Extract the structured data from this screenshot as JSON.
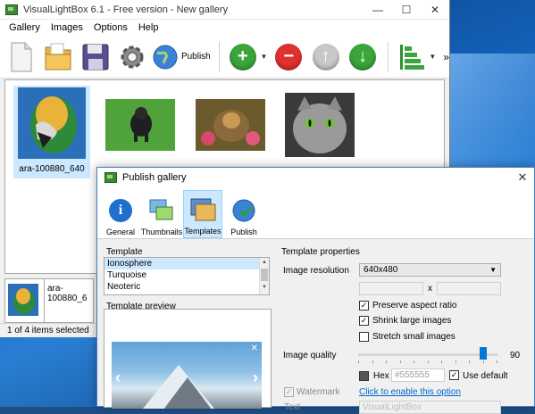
{
  "main_window": {
    "title": "VisualLightBox 6.1 - Free version - New gallery",
    "menu": [
      "Gallery",
      "Images",
      "Options",
      "Help"
    ],
    "toolbar": {
      "publish_label": "Publish",
      "buttons": [
        "new-document-icon",
        "open-folder-icon",
        "save-disk-icon",
        "settings-gear-icon",
        "publish-globe-icon",
        "add-icon",
        "remove-icon",
        "move-up-icon",
        "move-down-icon",
        "align-icon"
      ],
      "overflow": "»"
    },
    "gallery": {
      "selected_caption": "ara-100880_640"
    },
    "preview": {
      "name": "ara-100880_6"
    },
    "status": "1 of 4 items selected"
  },
  "dialog": {
    "title": "Publish gallery",
    "close": "✕",
    "tabs": [
      "General",
      "Thumbnails",
      "Templates",
      "Publish"
    ],
    "active_tab": "Templates",
    "template_group": "Template",
    "templates": [
      "Ionosphere",
      "Turquoise",
      "Neoteric"
    ],
    "selected_template": "Ionosphere",
    "template_preview_group": "Template preview",
    "properties_group": "Template properties",
    "image_resolution_label": "Image resolution",
    "image_resolution_value": "640x480",
    "x_separator": "x",
    "preserve_aspect": "Preserve aspect ratio",
    "shrink_large": "Shrink large images",
    "stretch_small": "Stretch small images",
    "image_quality_label": "Image quality",
    "image_quality_value": "90",
    "hex_label": "Hex",
    "hex_placeholder": "#555555",
    "use_default": "Use default",
    "watermark_label": "Watermark",
    "watermark_link": "Click to enable this option",
    "text_label": "Text",
    "text_placeholder": "VisualLightBox"
  },
  "colors": {
    "selection": "#cce8ff",
    "accent": "#0078d7",
    "link": "#0066cc"
  }
}
